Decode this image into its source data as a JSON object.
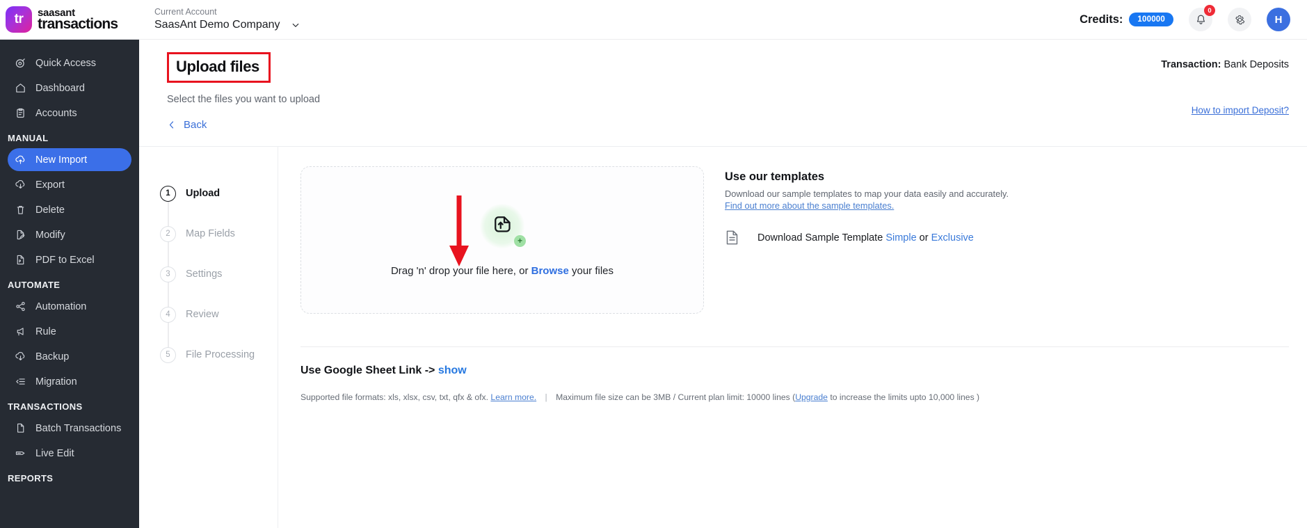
{
  "brand": {
    "line1": "saasant",
    "line2": "transactions",
    "mark": "tr",
    "mark_icon": "saasant-logo-icon"
  },
  "header": {
    "account_label": "Current Account",
    "account_value": "SaasAnt Demo Company",
    "account_caret_icon": "chevron-down-icon",
    "credits_label": "Credits:",
    "credits_value": "100000",
    "bell_icon": "bell-icon",
    "bell_badge": "0",
    "gear_icon": "gear-icon",
    "avatar_initial": "H",
    "accent_blue": "#1877f2",
    "badge_red": "#ef2b36",
    "avatar_blue": "#3b6fe0"
  },
  "sidebar": {
    "background": "#262b33",
    "active_color": "#3b6fe8",
    "items": [
      {
        "label": "Quick Access",
        "icon": "target-icon",
        "active": false
      },
      {
        "label": "Dashboard",
        "icon": "home-icon",
        "active": false
      },
      {
        "label": "Accounts",
        "icon": "clipboard-icon",
        "active": false
      }
    ],
    "groups": [
      {
        "title": "MANUAL",
        "items": [
          {
            "label": "New Import",
            "icon": "cloud-upload-icon",
            "active": true
          },
          {
            "label": "Export",
            "icon": "cloud-download-icon",
            "active": false
          },
          {
            "label": "Delete",
            "icon": "trash-icon",
            "active": false
          },
          {
            "label": "Modify",
            "icon": "file-edit-icon",
            "active": false
          },
          {
            "label": "PDF to Excel",
            "icon": "pdf-file-icon",
            "active": false
          }
        ]
      },
      {
        "title": "AUTOMATE",
        "items": [
          {
            "label": "Automation",
            "icon": "share-nodes-icon",
            "active": false
          },
          {
            "label": "Rule",
            "icon": "megaphone-icon",
            "active": false
          },
          {
            "label": "Backup",
            "icon": "cloud-download-icon",
            "active": false
          },
          {
            "label": "Migration",
            "icon": "list-arrow-icon",
            "active": false
          }
        ]
      },
      {
        "title": "TRANSACTIONS",
        "items": [
          {
            "label": "Batch Transactions",
            "icon": "document-icon",
            "active": false
          },
          {
            "label": "Live Edit",
            "icon": "tag-edit-icon",
            "active": false
          }
        ]
      },
      {
        "title": "REPORTS",
        "items": []
      }
    ]
  },
  "page": {
    "title": "Upload files",
    "title_highlight_color": "#e8131f",
    "subtitle": "Select the files you want to upload",
    "back_label": "Back",
    "back_icon": "chevron-left-icon",
    "transaction_label": "Transaction:",
    "transaction_value": "Bank Deposits",
    "how_to_link": "How to import Deposit?"
  },
  "stepper": {
    "steps": [
      {
        "num": "1",
        "label": "Upload",
        "active": true
      },
      {
        "num": "2",
        "label": "Map Fields",
        "active": false
      },
      {
        "num": "3",
        "label": "Settings",
        "active": false
      },
      {
        "num": "4",
        "label": "Review",
        "active": false
      },
      {
        "num": "5",
        "label": "File Processing",
        "active": false
      }
    ]
  },
  "dropzone": {
    "icon": "file-upload-icon",
    "plus_badge": "+",
    "text_before": "Drag 'n' drop your file here, or",
    "browse_label": "Browse",
    "text_after": "your files"
  },
  "templates": {
    "title": "Use our templates",
    "description": "Download our sample templates to map your data easily and  accurately.",
    "find_out_link": "Find out more about the sample templates.",
    "file_icon": "document-lines-icon",
    "download_text": "Download Sample Template",
    "simple_link": "Simple",
    "or_text": "or",
    "exclusive_link": "Exclusive"
  },
  "footer": {
    "google_sheet_text": "Use Google Sheet Link ->",
    "show_link": "show",
    "formats_text": "Supported file formats: xls, xlsx, csv, txt, qfx & ofx.",
    "learn_more_link": "Learn more.",
    "separator": "|",
    "max_size_text": "Maximum file size can be 3MB / Current plan limit: 10000 lines (",
    "upgrade_link": "Upgrade",
    "limit_tail_text": "to increase the limits upto 10,000 lines )"
  },
  "annotations": {
    "arrow_color": "#e8131f",
    "arrow_target": "browse-link",
    "box_target": "page-title"
  }
}
